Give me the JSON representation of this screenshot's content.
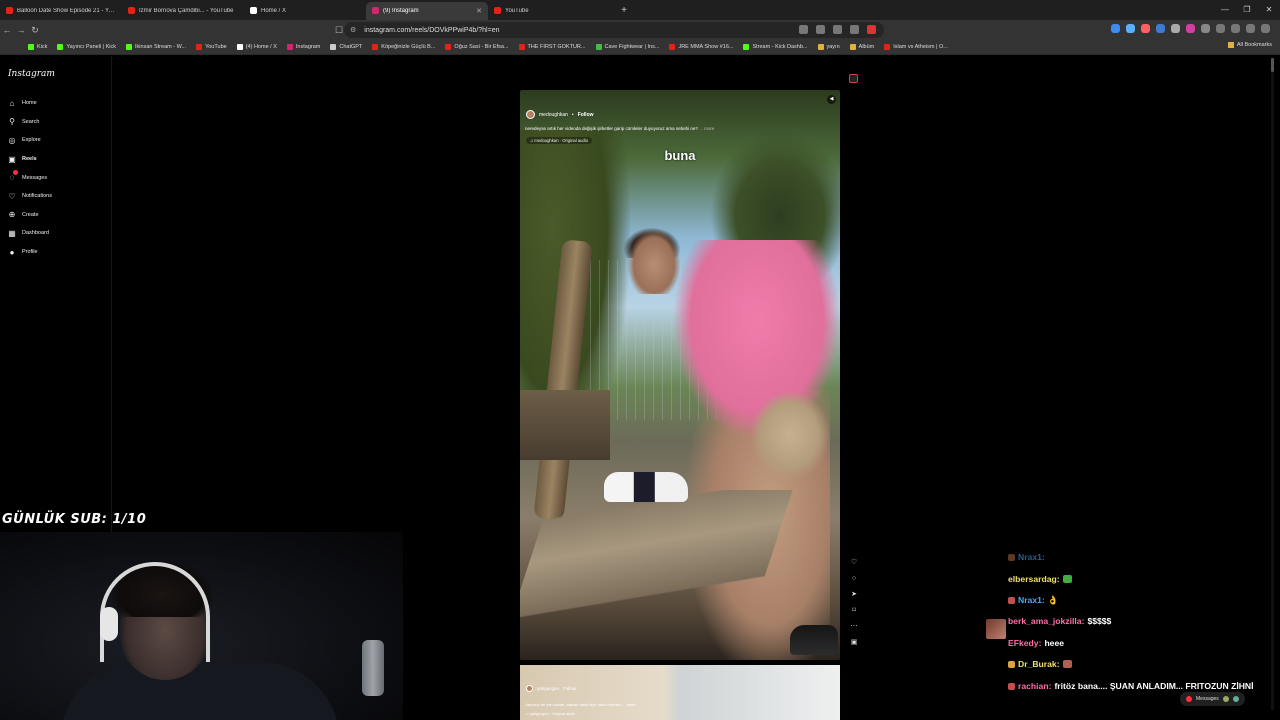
{
  "browser": {
    "tabs": [
      {
        "title": "Balloon Date Show Episode 21 - YouT",
        "fav": "#e62117",
        "active": false
      },
      {
        "title": "İzmir Bornova Çamdibi... - YouTube",
        "fav": "#e62117",
        "active": false
      },
      {
        "title": "Home / X",
        "fav": "#ffffff",
        "active": false
      },
      {
        "title": "(9) Instagram",
        "fav": "#d6246e",
        "active": true
      },
      {
        "title": "YouTube",
        "fav": "#e62117",
        "active": false
      }
    ],
    "new_tab": "+",
    "url": "instagram.com/reels/DOVkPPwiP4b/?hl=en",
    "bookmarks": [
      {
        "label": "Kick",
        "color": "#53fc18"
      },
      {
        "label": "Yayıncı Paneli | Kick",
        "color": "#53fc18"
      },
      {
        "label": "Ikinsan Stream - W...",
        "color": "#53fc18"
      },
      {
        "label": "YouTube",
        "color": "#e62117"
      },
      {
        "label": "(4) Home / X",
        "color": "#ffffff"
      },
      {
        "label": "Instagram",
        "color": "#d6246e"
      },
      {
        "label": "ChatGPT",
        "color": "#cccccc"
      },
      {
        "label": "Köpeğinizle Güçlü B...",
        "color": "#e62117"
      },
      {
        "label": "Oğuz Sasi - Bir Efsa...",
        "color": "#e62117"
      },
      {
        "label": "THE FIRST GOKTUR...",
        "color": "#e62117"
      },
      {
        "label": "Cave Fightwear | Ins...",
        "color": "#44bb44"
      },
      {
        "label": "JRE MMA Show #16...",
        "color": "#e62117"
      },
      {
        "label": "Stream - Kick Dashb...",
        "color": "#53fc18"
      },
      {
        "label": "yayın",
        "color": "#e0b040"
      },
      {
        "label": "Albüm",
        "color": "#e0b040"
      },
      {
        "label": "Islam vs Atheism | O...",
        "color": "#e62117"
      }
    ],
    "all_bookmarks": "All Bookmarks"
  },
  "instagram": {
    "logo": "Instagram",
    "nav": [
      {
        "label": "Home",
        "icon": "home-icon"
      },
      {
        "label": "Search",
        "icon": "search-icon"
      },
      {
        "label": "Explore",
        "icon": "explore-icon"
      },
      {
        "label": "Reels",
        "icon": "reels-icon",
        "active": true
      },
      {
        "label": "Messages",
        "icon": "messages-icon",
        "badge": true
      },
      {
        "label": "Notifications",
        "icon": "heart-icon"
      },
      {
        "label": "Create",
        "icon": "plus-icon"
      },
      {
        "label": "Dashboard",
        "icon": "dashboard-icon"
      },
      {
        "label": "Profile",
        "icon": "profile-icon"
      }
    ],
    "reel": {
      "username": "medoughkan",
      "dot": "•",
      "follow": "Follow",
      "caption": "neredeyse artık her videoda değişik şirketler garip cümleler duyuyoruz ama sebebi ne?",
      "more": "... more",
      "audio": "♫ medoughkan · Original audio",
      "overlay_word": "buna"
    },
    "next_reel": {
      "username": "yarigucgun",
      "follow": "Follow",
      "caption": "Jaymeyi de ipin sakatı, başları nasıl diye nasıl izlemler",
      "more": "... more",
      "audio": "♫ yarigucgun · Original audio"
    }
  },
  "stream": {
    "sub_goal": "GÜNLÜK SUB: 1/10",
    "chat": [
      {
        "user": "Nrax1:",
        "text": "",
        "color": "#4aa8ff",
        "badge": "#aa6644"
      },
      {
        "user": "elbersardag:",
        "text": "",
        "color": "#f0e060",
        "emote": "#3fae3f"
      },
      {
        "user": "Nrax1:",
        "text": "👌",
        "color": "#4aa8ff",
        "badge": "#c0504d"
      },
      {
        "user": "berk_ama_jokzilla:",
        "text": "$$$$$",
        "color": "#ff6fa8"
      },
      {
        "user": "EFkedy:",
        "text": "heee",
        "color": "#ff6fa8"
      },
      {
        "user": "Dr_Burak:",
        "text": "",
        "color": "#f0e060",
        "badge": "#e0a040",
        "emote": "#b06050"
      },
      {
        "user": "rachian:",
        "text": "fritöz bana.... ŞUAN ANLADIM... FRITOZUN ZİHNİ",
        "color": "#ff6fa8",
        "badge": "#c0504d"
      }
    ],
    "messages_label": "Messages"
  }
}
